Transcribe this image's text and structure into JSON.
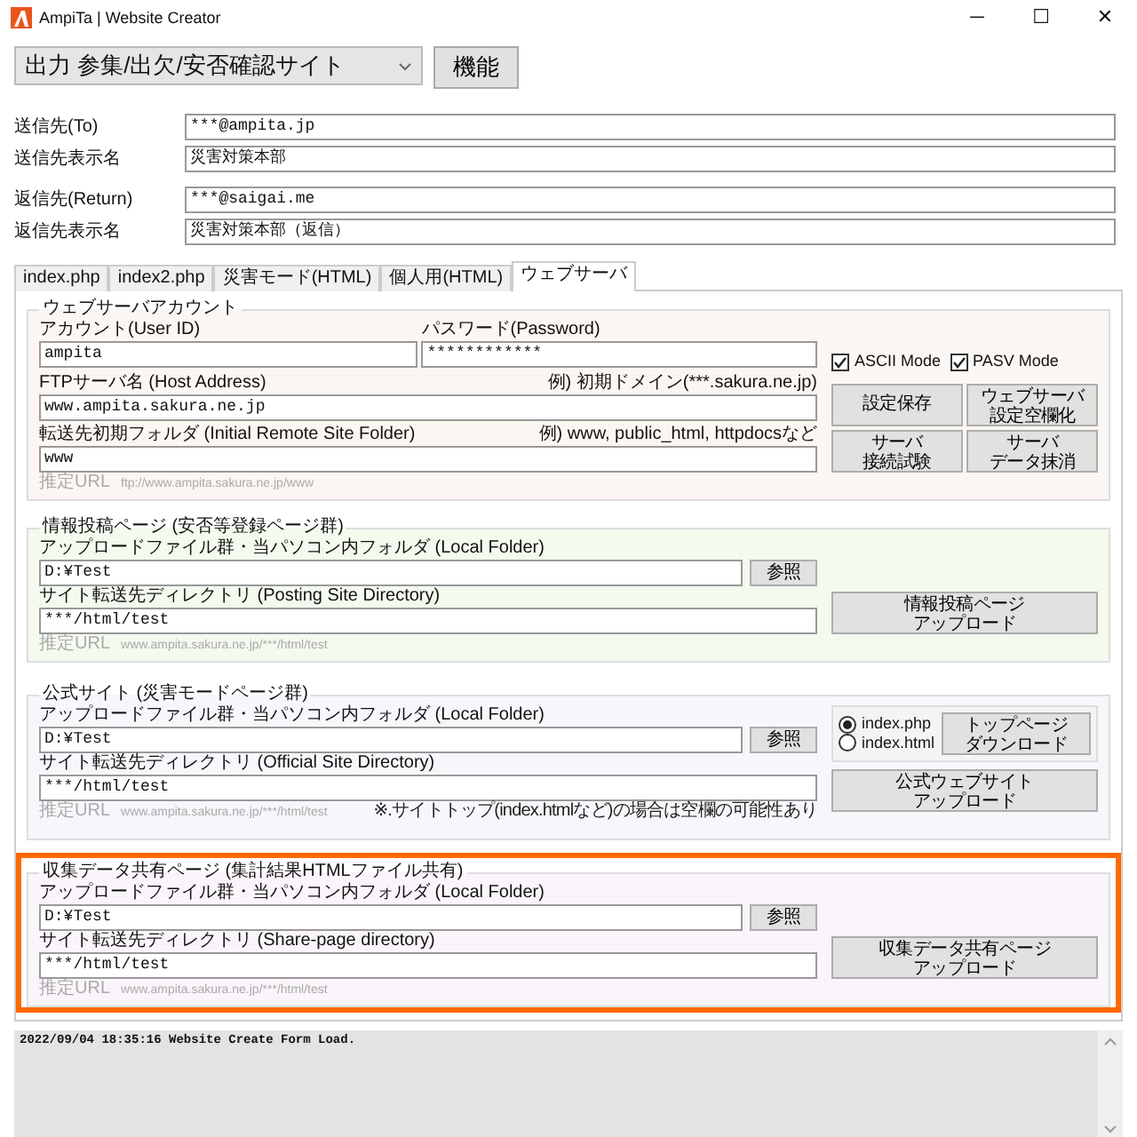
{
  "window": {
    "title": "AmpiTa | Website Creator",
    "controls": [
      "─",
      "☐",
      "✕"
    ]
  },
  "toolbar": {
    "site_select": "出力 参集/出欠/安否確認サイト",
    "function_button": "機能"
  },
  "address_groups": [
    [
      {
        "label": "送信先(To)",
        "value": "***@ampita.jp"
      },
      {
        "label": "送信先表示名",
        "value": "災害対策本部"
      }
    ],
    [
      {
        "label": "返信先(Return)",
        "value": "***@saigai.me"
      },
      {
        "label": "返信先表示名",
        "value": "災害対策本部（返信）"
      }
    ]
  ],
  "tabs": [
    {
      "label": "index.php",
      "selected": false
    },
    {
      "label": "index2.php",
      "selected": false
    },
    {
      "label": "災害モード(HTML)",
      "selected": false
    },
    {
      "label": "個人用(HTML)",
      "selected": false
    },
    {
      "label": "ウェブサーバ",
      "selected": true
    }
  ],
  "server_account": {
    "legend": "ウェブサーバアカウント",
    "account": {
      "label": "アカウント(User ID)",
      "value": "ampita"
    },
    "password": {
      "label": "パスワード(Password)",
      "value": "************"
    },
    "options": [
      {
        "label": "ASCII Mode",
        "checked": true
      },
      {
        "label": "PASV Mode",
        "checked": true
      }
    ],
    "host": {
      "label": "FTPサーバ名 (Host Address)",
      "hint": "例) 初期ドメイン(***.sakura.ne.jp)",
      "value": "www.ampita.sakura.ne.jp"
    },
    "folder": {
      "label": "転送先初期フォルダ (Initial Remote Site Folder)",
      "hint": "例) www, public_html, httpdocsなど",
      "value": "www"
    },
    "url_note": {
      "label": "推定URL",
      "value": "ftp://www.ampita.sakura.ne.jp/www"
    },
    "buttons": [
      [
        "設定保存"
      ],
      [
        "ウェブサーバ",
        "設定空欄化"
      ],
      [
        "サーバ",
        "接続試験"
      ],
      [
        "サーバ",
        "データ抹消"
      ]
    ]
  },
  "sections": [
    {
      "legend": "情報投稿ページ (安否等登録ページ群)",
      "color": "#f4faee",
      "highlighted": false,
      "local": {
        "label": "アップロードファイル群・当パソコン内フォルダ (Local Folder)",
        "value": "D:¥Test"
      },
      "browse": "参照",
      "remote": {
        "label": "サイト転送先ディレクトリ (Posting Site Directory)",
        "value": "***/html/test"
      },
      "url_note": {
        "label": "推定URL",
        "value": "www.ampita.sakura.ne.jp/***/html/test"
      },
      "upload": [
        "情報投稿ページ",
        "アップロード"
      ]
    },
    {
      "legend": "公式サイト (災害モードページ群)",
      "color": "#f6f7fb",
      "highlighted": false,
      "local": {
        "label": "アップロードファイル群・当パソコン内フォルダ (Local Folder)",
        "value": "D:¥Test"
      },
      "browse": "参照",
      "remote": {
        "label": "サイト転送先ディレクトリ (Official Site Directory)",
        "value": "***/html/test",
        "note": "※.サイトトップ(index.htmlなど)の場合は空欄の可能性あり"
      },
      "url_note": {
        "label": "推定URL",
        "value": "www.ampita.sakura.ne.jp/***/html/test"
      },
      "radios": [
        {
          "label": "index.php",
          "selected": true
        },
        {
          "label": "index.html",
          "selected": false
        }
      ],
      "download": [
        "トップページ",
        "ダウンロード"
      ],
      "upload": [
        "公式ウェブサイト",
        "アップロード"
      ]
    },
    {
      "legend": "収集データ共有ページ (集計結果HTMLファイル共有)",
      "color": "#faf5fa",
      "highlighted": true,
      "local": {
        "label": "アップロードファイル群・当パソコン内フォルダ (Local Folder)",
        "value": "D:¥Test"
      },
      "browse": "参照",
      "remote": {
        "label": "サイト転送先ディレクトリ (Share-page directory)",
        "value": "***/html/test"
      },
      "url_note": {
        "label": "推定URL",
        "value": "www.ampita.sakura.ne.jp/***/html/test"
      },
      "upload": [
        "収集データ共有ページ",
        "アップロード"
      ]
    }
  ],
  "log": {
    "lines": [
      "2022/09/04 18:35:16 Website Create Form Load."
    ]
  }
}
